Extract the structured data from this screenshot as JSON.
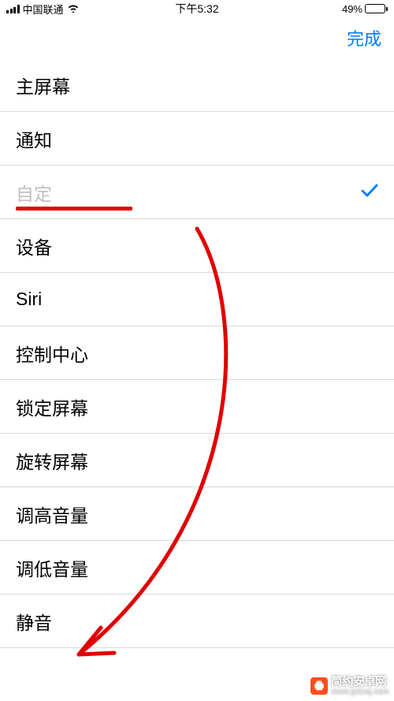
{
  "statusBar": {
    "carrier": "中国联通",
    "time": "下午5:32",
    "batteryPercent": "49%"
  },
  "navBar": {
    "doneLabel": "完成"
  },
  "list": {
    "items": [
      {
        "label": "主屏幕"
      },
      {
        "label": "通知"
      },
      {
        "label": "自定",
        "placeholder": true,
        "checked": true,
        "underlined": true
      },
      {
        "label": "设备"
      },
      {
        "label": "Siri"
      },
      {
        "label": "控制中心"
      },
      {
        "label": "锁定屏幕"
      },
      {
        "label": "旋转屏幕"
      },
      {
        "label": "调高音量"
      },
      {
        "label": "调低音量"
      },
      {
        "label": "静音"
      }
    ]
  },
  "watermark": {
    "title": "简约安卓网",
    "url": "www.jylzwj.com"
  },
  "annotation": {
    "arrowColor": "#e00000"
  }
}
